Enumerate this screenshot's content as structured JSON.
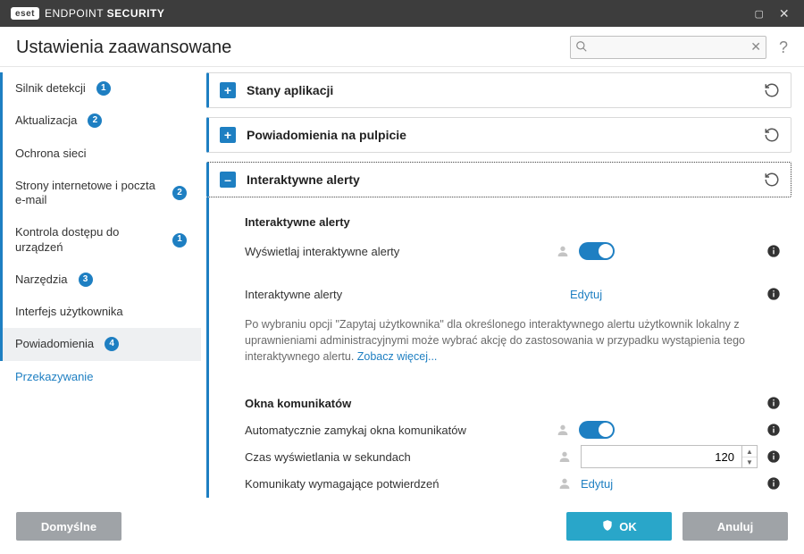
{
  "window": {
    "brand_short": "eset",
    "title_light": "ENDPOINT",
    "title_bold": "SECURITY"
  },
  "header": {
    "page_title": "Ustawienia zaawansowane",
    "search_placeholder": "",
    "help_symbol": "?"
  },
  "sidebar": {
    "items": [
      {
        "label": "Silnik detekcji",
        "badge": "1",
        "accent": true
      },
      {
        "label": "Aktualizacja",
        "badge": "2",
        "accent": true
      },
      {
        "label": "Ochrona sieci",
        "badge": null,
        "accent": true
      },
      {
        "label": "Strony internetowe i poczta e-mail",
        "badge": "2",
        "accent": true
      },
      {
        "label": "Kontrola dostępu do urządzeń",
        "badge": "1",
        "accent": true
      },
      {
        "label": "Narzędzia",
        "badge": "3",
        "accent": true
      },
      {
        "label": "Interfejs użytkownika",
        "badge": null,
        "accent": true
      },
      {
        "label": "Powiadomienia",
        "badge": "4",
        "accent": true,
        "active": true
      },
      {
        "label": "Przekazywanie",
        "badge": null,
        "accent": false,
        "sub": true
      }
    ]
  },
  "content": {
    "panels": [
      {
        "title": "Stany aplikacji",
        "expanded": false
      },
      {
        "title": "Powiadomienia na pulpicie",
        "expanded": false
      },
      {
        "title": "Interaktywne alerty",
        "expanded": true
      }
    ],
    "alerts": {
      "heading": "Interaktywne alerty",
      "show_label": "Wyświetlaj interaktywne alerty",
      "show_value": true,
      "edit_label": "Interaktywne alerty",
      "edit_link": "Edytuj",
      "description": "Po wybraniu opcji \"Zapytaj użytkownika\" dla określonego interaktywnego alertu użytkownik lokalny z uprawnieniami administracyjnymi może wybrać akcję do zastosowania w przypadku wystąpienia tego interaktywnego alertu. ",
      "description_link": "Zobacz więcej..."
    },
    "msgboxes": {
      "heading": "Okna komunikatów",
      "auto_close_label": "Automatycznie zamykaj okna komunikatów",
      "auto_close_value": true,
      "timeout_label": "Czas wyświetlania w sekundach",
      "timeout_value": "120",
      "confirm_label": "Komunikaty wymagające potwierdzeń",
      "confirm_link": "Edytuj"
    }
  },
  "footer": {
    "default_btn": "Domyślne",
    "ok_btn": "OK",
    "cancel_btn": "Anuluj"
  }
}
